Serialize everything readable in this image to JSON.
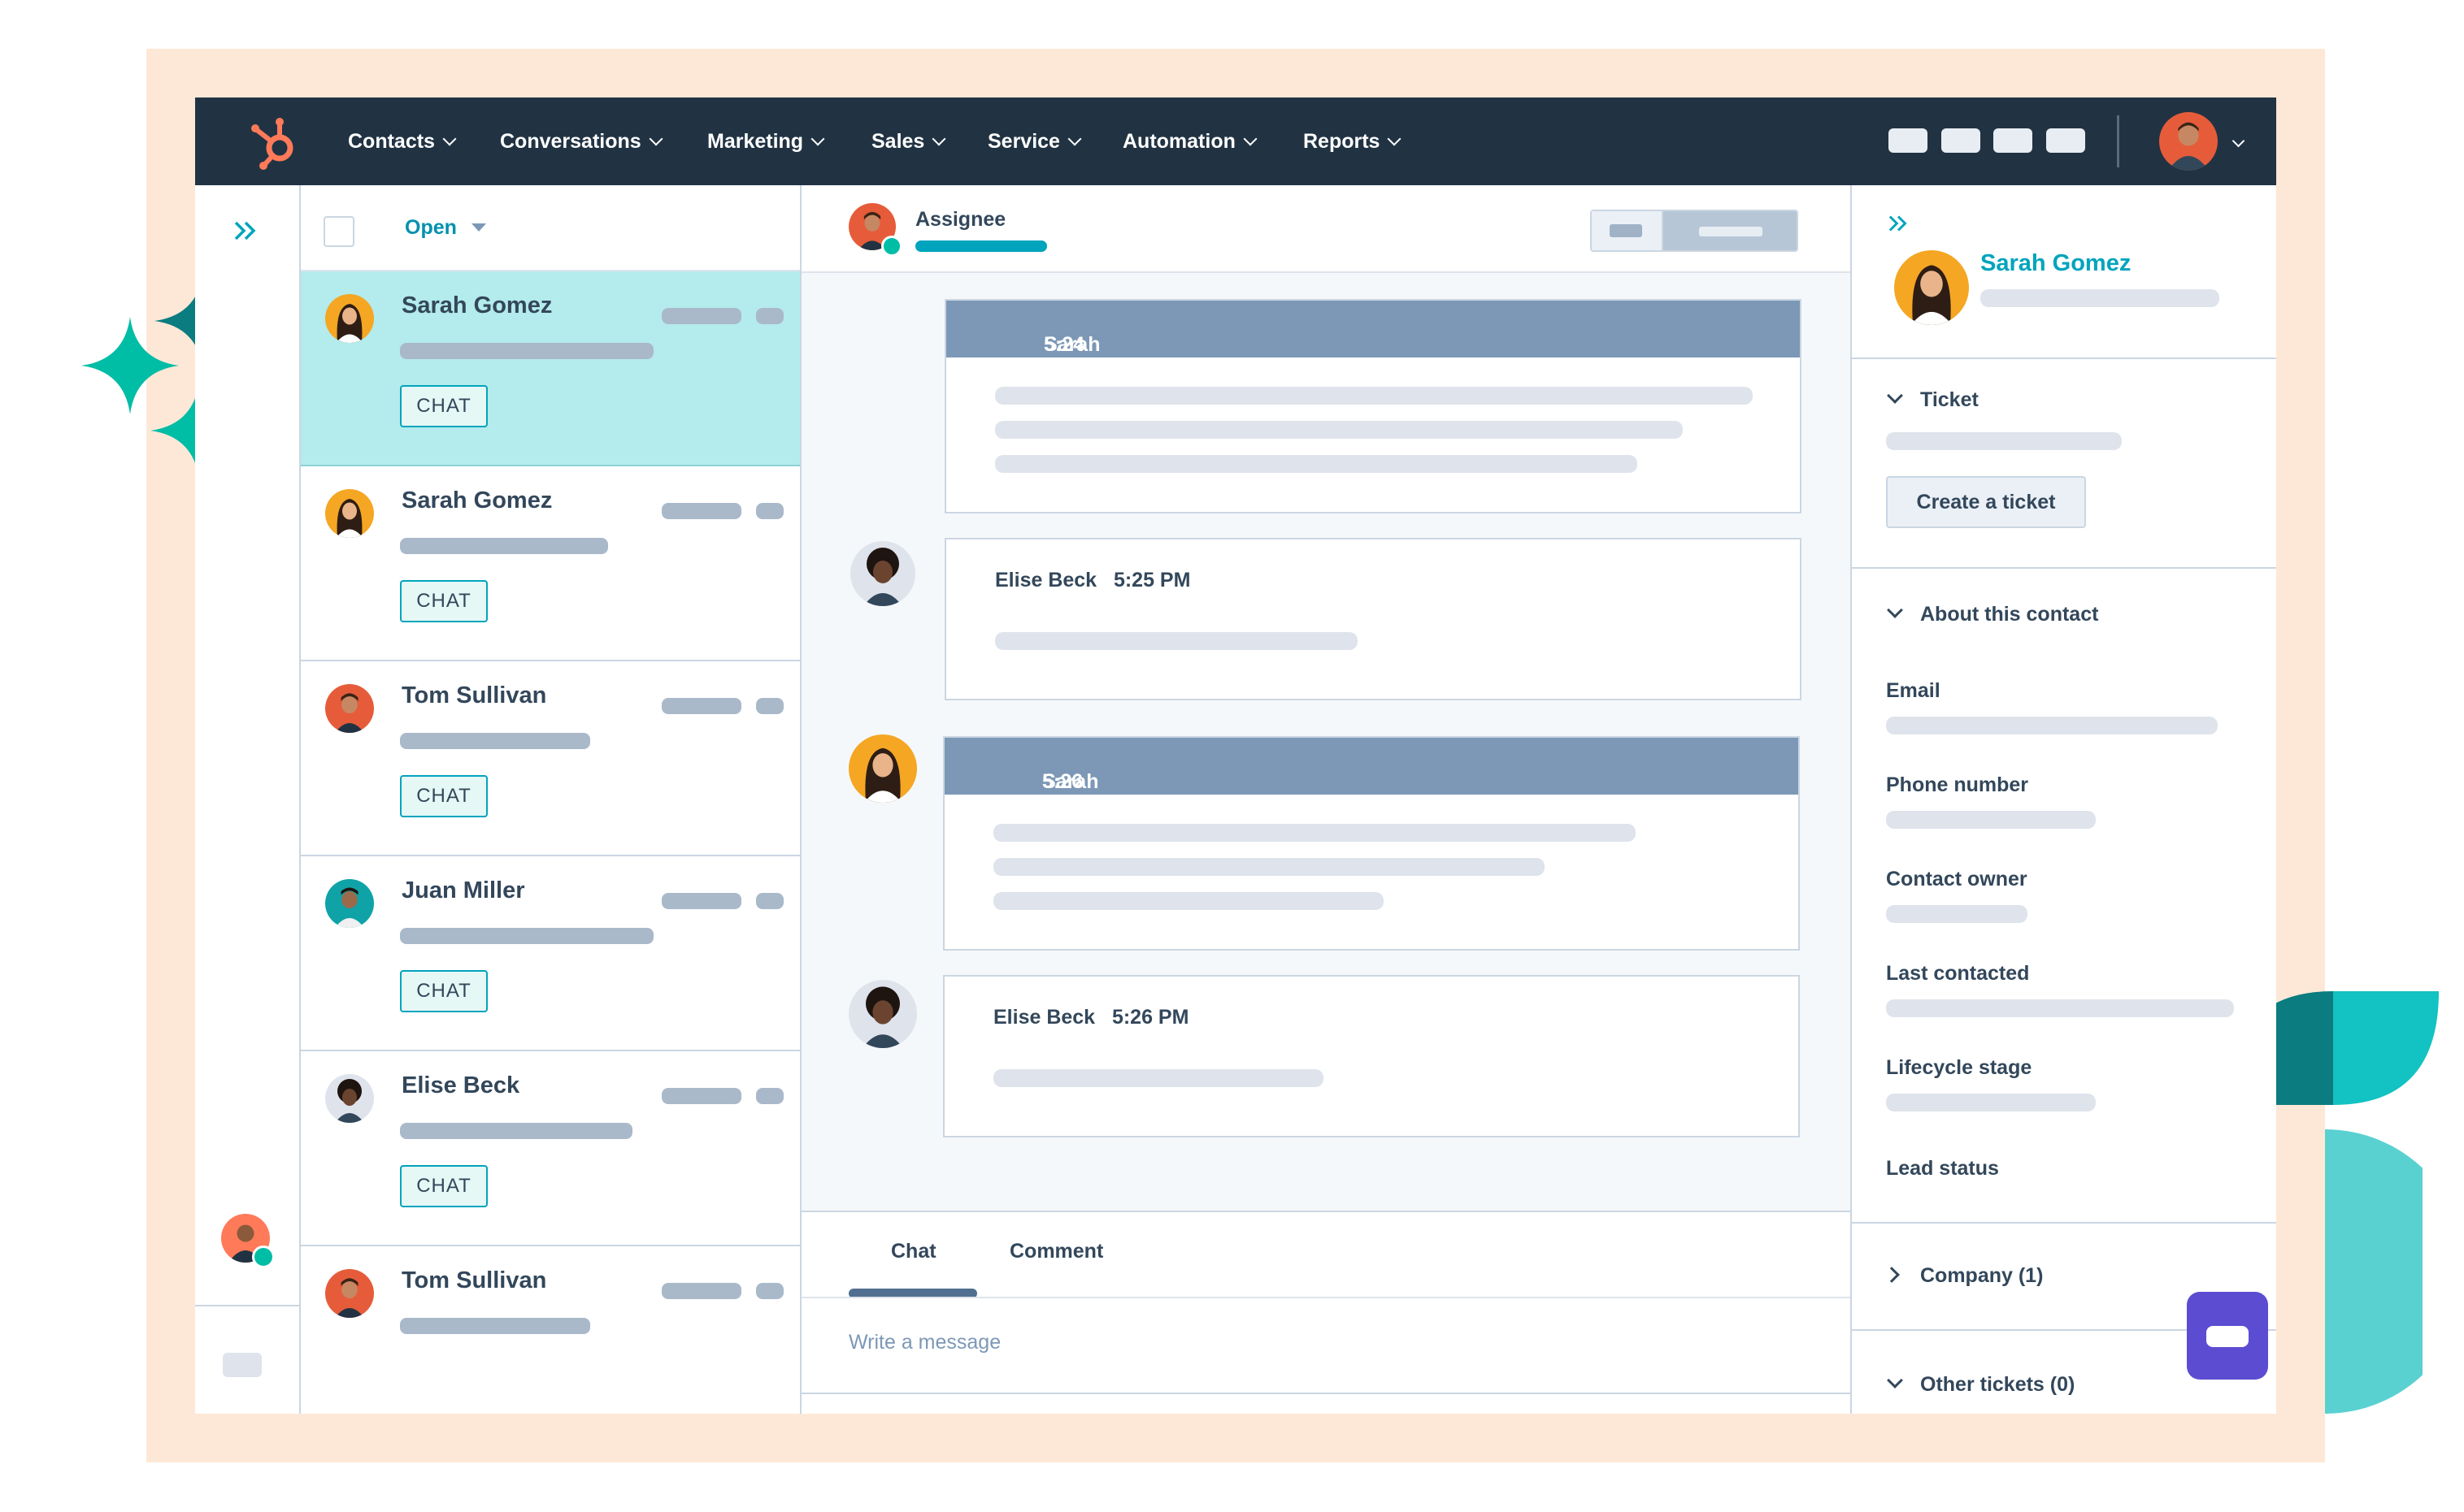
{
  "nav": {
    "items": [
      {
        "label": "Contacts"
      },
      {
        "label": "Conversations"
      },
      {
        "label": "Marketing"
      },
      {
        "label": "Sales"
      },
      {
        "label": "Service"
      },
      {
        "label": "Automation"
      },
      {
        "label": "Reports"
      }
    ]
  },
  "inbox": {
    "filter_label": "Open",
    "conversations": [
      {
        "name": "Sarah Gomez",
        "badge": "CHAT",
        "selected": true
      },
      {
        "name": "Sarah Gomez",
        "badge": "CHAT",
        "selected": false
      },
      {
        "name": "Tom Sullivan",
        "badge": "CHAT",
        "selected": false
      },
      {
        "name": "Juan Miller",
        "badge": "CHAT",
        "selected": false
      },
      {
        "name": "Elise Beck",
        "badge": "CHAT",
        "selected": false
      },
      {
        "name": "Tom Sullivan",
        "badge": "",
        "selected": false
      }
    ]
  },
  "thread": {
    "assignee_label": "Assignee",
    "messages": [
      {
        "sender": "Sarah Gomez",
        "time": "5:24 PM",
        "style": "header"
      },
      {
        "sender": "Elise Beck",
        "time": "5:25 PM",
        "style": "plain"
      },
      {
        "sender": "Sarah Gomez",
        "time": "5:26 PM",
        "style": "header"
      },
      {
        "sender": "Elise Beck",
        "time": "5:26 PM",
        "style": "plain"
      }
    ]
  },
  "composer": {
    "tabs": [
      {
        "label": "Chat",
        "active": true
      },
      {
        "label": "Comment",
        "active": false
      }
    ],
    "placeholder": "Write a message"
  },
  "sidebar": {
    "contact_name": "Sarah Gomez",
    "ticket_label": "Ticket",
    "create_ticket_label": "Create a ticket",
    "about_label": "About this contact",
    "fields": [
      {
        "label": "Email"
      },
      {
        "label": "Phone number"
      },
      {
        "label": "Contact owner"
      },
      {
        "label": "Last contacted"
      },
      {
        "label": "Lifecycle stage"
      },
      {
        "label": "Lead status"
      }
    ],
    "company_label": "Company (1)",
    "other_tickets_label": "Other tickets (0)"
  },
  "colors": {
    "nav_bg": "#213343",
    "accent_teal": "#00a4bd",
    "brand_orange": "#ff7a59",
    "selected_row": "#b4ebec",
    "message_header": "#7c98b6",
    "frame": "#fde8d7",
    "launcher": "#5c4cd1"
  },
  "icons": [
    "hubspot-logo-icon",
    "expand-icon",
    "caret-down-icon",
    "chevron-down-icon",
    "chevron-right-icon",
    "chat-launcher-icon",
    "sparkle-icon"
  ]
}
